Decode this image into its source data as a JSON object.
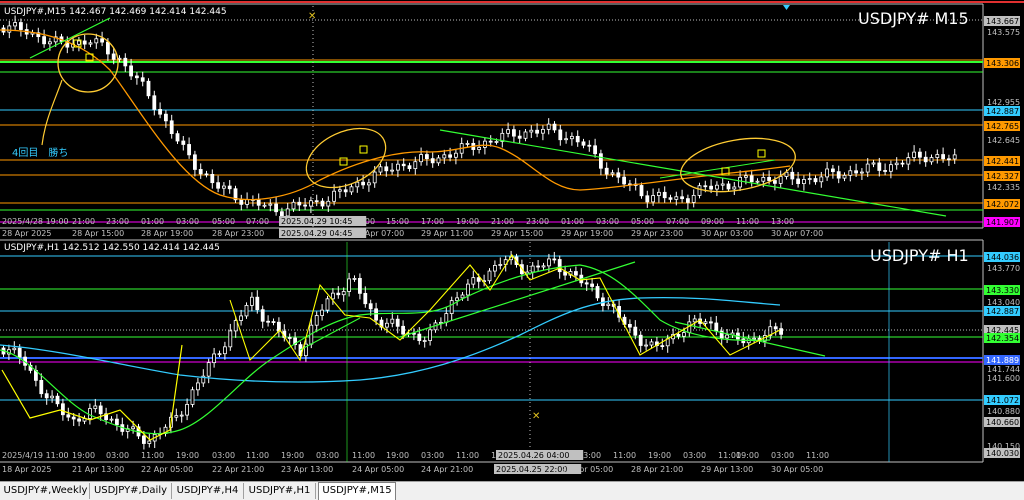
{
  "top_chart": {
    "symbol_label": "USDJPY#,M15",
    "ohlc": "142.467 142.469 142.414 142.445",
    "watermark": "USDJPY# M15",
    "annotation": "4回目　勝ち",
    "price_ticks": [
      "143.575",
      "142.955",
      "142.645",
      "142.335"
    ],
    "price_tags": [
      {
        "value": "143.667",
        "color": "#c0c0c0",
        "text_color": "#000"
      },
      {
        "value": "143.306",
        "color": "#ff9900",
        "text_color": "#000"
      },
      {
        "value": "142.887",
        "color": "#33ccff",
        "text_color": "#000"
      },
      {
        "value": "142.765",
        "color": "#ff9900",
        "text_color": "#000"
      },
      {
        "value": "142.441",
        "color": "#ff9900",
        "text_color": "#000"
      },
      {
        "value": "142.327",
        "color": "#ff9900",
        "text_color": "#000"
      },
      {
        "value": "142.072",
        "color": "#ff9900",
        "text_color": "#000"
      },
      {
        "value": "141.907",
        "color": "#ff00ff",
        "text_color": "#000"
      }
    ],
    "time_row1": [
      "2025/4/28 19:00",
      "21:00",
      "23:00",
      "01:00",
      "03:00",
      "05:00",
      "07:00",
      "2025.04.29 10:45",
      "13:00",
      "15:00",
      "17:00",
      "19:00",
      "21:00",
      "23:00",
      "01:00",
      "03:00",
      "05:00",
      "07:00",
      "09:00",
      "11:00",
      "13:00"
    ],
    "time_row2": [
      "28 Apr 2025",
      "28 Apr 15:00",
      "28 Apr 19:00",
      "28 Apr 23:00",
      "2025.04.29 04:45",
      "29 Apr 07:00",
      "29 Apr 11:00",
      "29 Apr 15:00",
      "29 Apr 19:00",
      "29 Apr 23:00",
      "30 Apr 03:00",
      "30 Apr 07:00"
    ]
  },
  "bottom_chart": {
    "symbol_label": "USDJPY#,H1",
    "ohlc": "142.512 142.550 142.414 142.445",
    "watermark": "USDJPY# H1",
    "price_ticks": [
      "143.770",
      "143.040",
      "141.744",
      "141.600",
      "140.880",
      "140.150"
    ],
    "price_tags": [
      {
        "value": "144.036",
        "color": "#33ccff",
        "text_color": "#000"
      },
      {
        "value": "143.330",
        "color": "#33ff33",
        "text_color": "#000"
      },
      {
        "value": "142.887",
        "color": "#33ccff",
        "text_color": "#000"
      },
      {
        "value": "142.445",
        "color": "#c0c0c0",
        "text_color": "#000"
      },
      {
        "value": "142.354",
        "color": "#33ff33",
        "text_color": "#000"
      },
      {
        "value": "141.889",
        "color": "#3366ff",
        "text_color": "#fff"
      },
      {
        "value": "141.072",
        "color": "#33ccff",
        "text_color": "#000"
      },
      {
        "value": "140.660",
        "color": "#c0c0c0",
        "text_color": "#000"
      },
      {
        "value": "140.030",
        "color": "#c0c0c0",
        "text_color": "#000"
      }
    ],
    "time_row1": [
      "2025/4/19 11:00",
      "19:00",
      "03:00",
      "11:00",
      "19:00",
      "03:00",
      "11:00",
      "19:00",
      "03:00",
      "11:00",
      "19:00",
      "03:00",
      "11:00",
      "19:00",
      "2025.04.26 04:00",
      "03:00",
      "11:00",
      "19:00",
      "03:00",
      "11:00",
      "19:00",
      "03:00",
      "11:00"
    ],
    "time_row2": [
      "18 Apr 2025",
      "21 Apr 13:00",
      "22 Apr 05:00",
      "22 Apr 21:00",
      "23 Apr 13:00",
      "24 Apr 05:00",
      "24 Apr 21:00",
      "2025.04.25 22:00",
      "28 Apr 05:00",
      "28 Apr 21:00",
      "29 Apr 13:00",
      "30 Apr 05:00"
    ]
  },
  "tabs": [
    {
      "label": "USDJPY#,Weekly",
      "active": false
    },
    {
      "label": "USDJPY#,Daily",
      "active": false
    },
    {
      "label": "USDJPY#,H4",
      "active": false
    },
    {
      "label": "USDJPY#,H1",
      "active": false
    },
    {
      "label": "USDJPY#,M15",
      "active": true
    }
  ]
}
